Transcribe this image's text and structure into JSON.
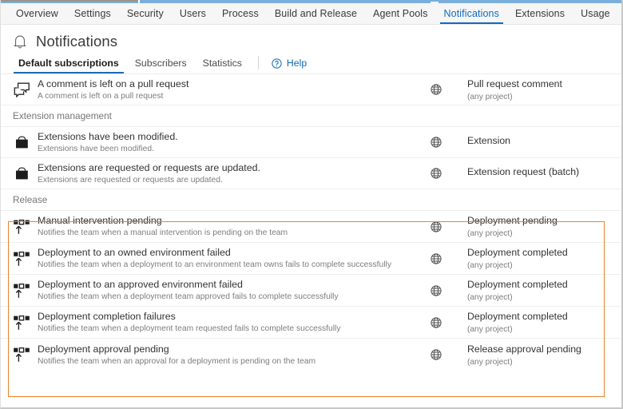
{
  "nav": {
    "tabs": [
      {
        "label": "Overview",
        "active": false
      },
      {
        "label": "Settings",
        "active": false
      },
      {
        "label": "Security",
        "active": false
      },
      {
        "label": "Users",
        "active": false
      },
      {
        "label": "Process",
        "active": false
      },
      {
        "label": "Build and Release",
        "active": false
      },
      {
        "label": "Agent Pools",
        "active": false
      },
      {
        "label": "Notifications",
        "active": true
      },
      {
        "label": "Extensions",
        "active": false
      },
      {
        "label": "Usage",
        "active": false
      }
    ],
    "active_color": "#0f6cbd"
  },
  "header": {
    "title": "Notifications",
    "icon": "bell-icon"
  },
  "pivot": {
    "tabs": [
      {
        "label": "Default subscriptions",
        "active": true
      },
      {
        "label": "Subscribers",
        "active": false
      },
      {
        "label": "Statistics",
        "active": false
      }
    ],
    "help_label": "Help",
    "help_icon": "question-circle-icon",
    "help_color": "#1268b3",
    "active_underline_color": "#1a6bb5"
  },
  "highlight": {
    "color": "#e8842c",
    "target_group": "Release"
  },
  "groups": [
    {
      "name": "",
      "header": null,
      "highlighted": false,
      "rows": [
        {
          "icon": "comment-bubbles-icon",
          "title": "A comment is left on a pull request",
          "description": "A comment is left on a pull request",
          "scope_icon": "globe-icon",
          "event": "Pull request comment",
          "project": "(any project)"
        }
      ]
    },
    {
      "name": "Extension management",
      "header": "Extension management",
      "highlighted": false,
      "rows": [
        {
          "icon": "briefcase-icon",
          "title": "Extensions have been modified.",
          "description": "Extensions have been modified.",
          "scope_icon": "globe-icon",
          "event": "Extension",
          "project": ""
        },
        {
          "icon": "briefcase-icon",
          "title": "Extensions are requested or requests are updated.",
          "description": "Extensions are requested or requests are updated.",
          "scope_icon": "globe-icon",
          "event": "Extension request (batch)",
          "project": ""
        }
      ]
    },
    {
      "name": "Release",
      "header": "Release",
      "highlighted": true,
      "rows": [
        {
          "icon": "release-deploy-icon",
          "title": "Manual intervention pending",
          "description": "Notifies the team when a manual intervention is pending on the team",
          "scope_icon": "globe-icon",
          "event": "Deployment pending",
          "project": "(any project)"
        },
        {
          "icon": "release-deploy-icon",
          "title": "Deployment to an owned environment failed",
          "description": "Notifies the team when a deployment to an environment team owns fails to complete successfully",
          "scope_icon": "globe-icon",
          "event": "Deployment completed",
          "project": "(any project)"
        },
        {
          "icon": "release-deploy-icon",
          "title": "Deployment to an approved environment failed",
          "description": "Notifies the team when a deployment team approved fails to complete successfully",
          "scope_icon": "globe-icon",
          "event": "Deployment completed",
          "project": "(any project)"
        },
        {
          "icon": "release-deploy-icon",
          "title": "Deployment completion failures",
          "description": "Notifies the team when a deployment team requested fails to complete successfully",
          "scope_icon": "globe-icon",
          "event": "Deployment completed",
          "project": "(any project)"
        },
        {
          "icon": "release-deploy-icon",
          "title": "Deployment approval pending",
          "description": "Notifies the team when an approval for a deployment is pending on the team",
          "scope_icon": "globe-icon",
          "event": "Release approval pending",
          "project": "(any project)"
        }
      ]
    }
  ]
}
